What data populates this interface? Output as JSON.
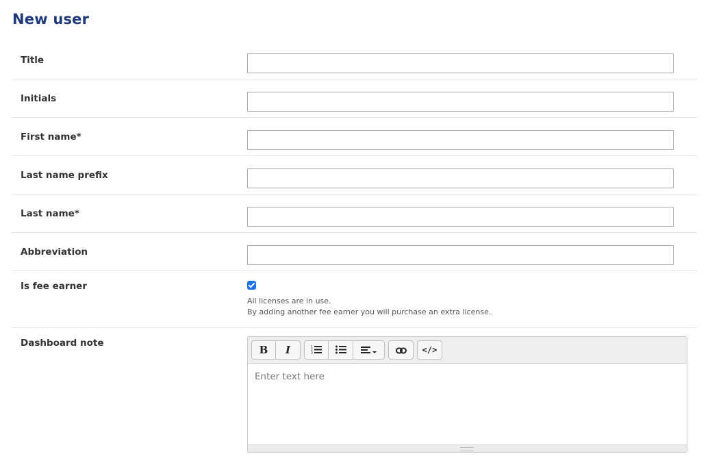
{
  "page": {
    "title": "New user"
  },
  "fields": [
    {
      "label": "Title",
      "value": ""
    },
    {
      "label": "Initials",
      "value": ""
    },
    {
      "label": "First name*",
      "value": ""
    },
    {
      "label": "Last name prefix",
      "value": ""
    },
    {
      "label": "Last name*",
      "value": ""
    },
    {
      "label": "Abbreviation",
      "value": ""
    }
  ],
  "fee_earner": {
    "label": "Is fee earner",
    "checked": true,
    "help_line1": "All licenses are in use.",
    "help_line2": "By adding another fee earner you will purchase an extra license."
  },
  "dashboard_note": {
    "label": "Dashboard note",
    "placeholder": "Enter text here",
    "toolbar": {
      "bold_glyph": "B",
      "italic_glyph": "I",
      "ordered_list_icon": "ordered-list-icon",
      "unordered_list_icon": "unordered-list-icon",
      "align_icon": "align-left-icon",
      "link_icon": "link-icon",
      "code_glyph": "</>"
    }
  },
  "colors": {
    "title": "#1f3a7a",
    "checkbox": "#1a73e8"
  }
}
